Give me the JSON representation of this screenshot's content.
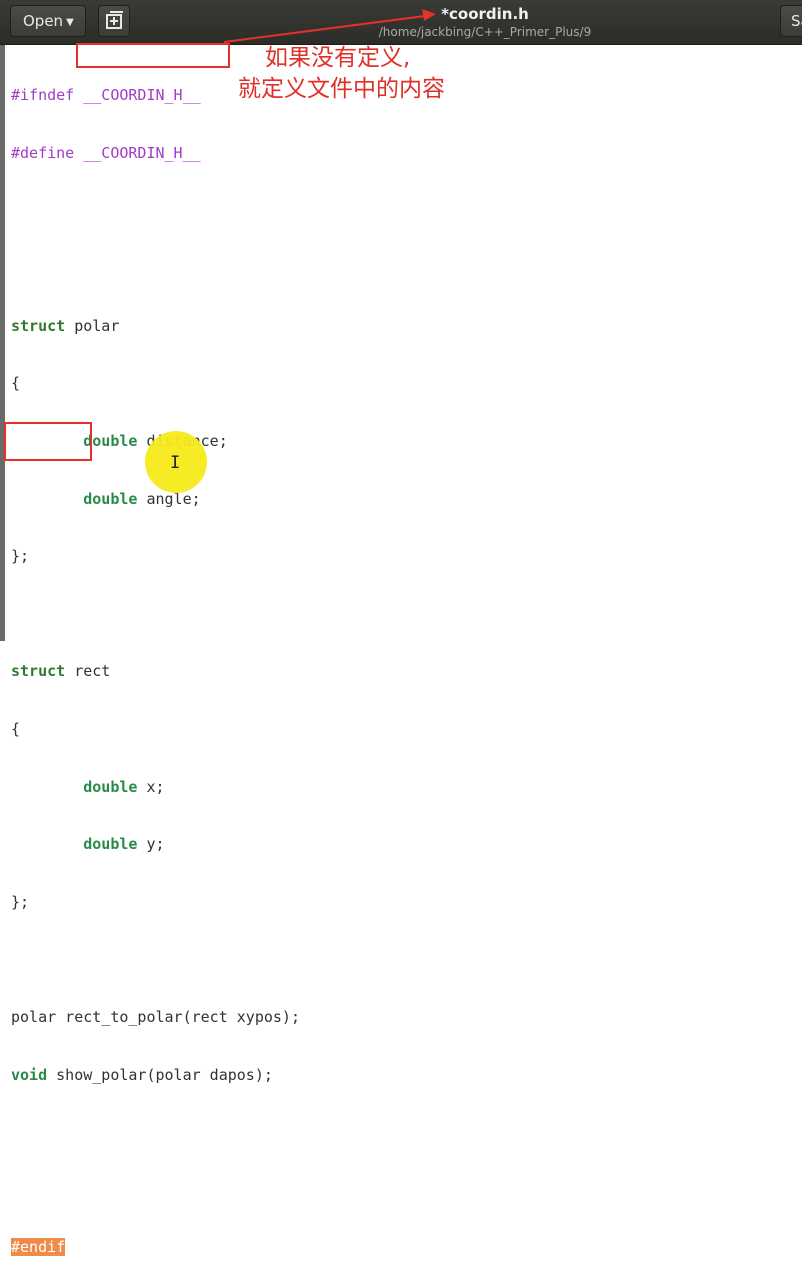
{
  "header": {
    "open_label": "Open",
    "title": "*coordin.h",
    "path": "/home/jackbing/C++_Primer_Plus/9",
    "save_label": "Save"
  },
  "code": {
    "l1": {
      "directive": "#ifndef",
      "name": "__COORDIN_H__"
    },
    "l2": {
      "directive": "#define",
      "name": "__COORDIN_H__"
    },
    "l5": {
      "kw": "struct",
      "name": "polar"
    },
    "brace_open": "{",
    "brace_close": "};",
    "l7": {
      "type": "double",
      "rest": "distance;"
    },
    "l8": {
      "type": "double",
      "rest": "angle;"
    },
    "l11": {
      "kw": "struct",
      "name": "rect"
    },
    "l13": {
      "type": "double",
      "rest": "x;"
    },
    "l14": {
      "type": "double",
      "rest": "y;"
    },
    "l17": {
      "text": "polar rect_to_polar(rect xypos);"
    },
    "l18": {
      "kw": "void",
      "rest": "show_polar(polar dapos);"
    },
    "l21": {
      "directive": "#endif"
    }
  },
  "annotation": {
    "line1": "如果没有定义,",
    "line2": "就定义文件中的内容"
  },
  "colors": {
    "preprocessor": "#a33bc7",
    "keyword": "#2f7a2f",
    "annotation": "#e4312b",
    "selection": "#f08a4b",
    "cursor_highlight": "#f7ea1a"
  }
}
